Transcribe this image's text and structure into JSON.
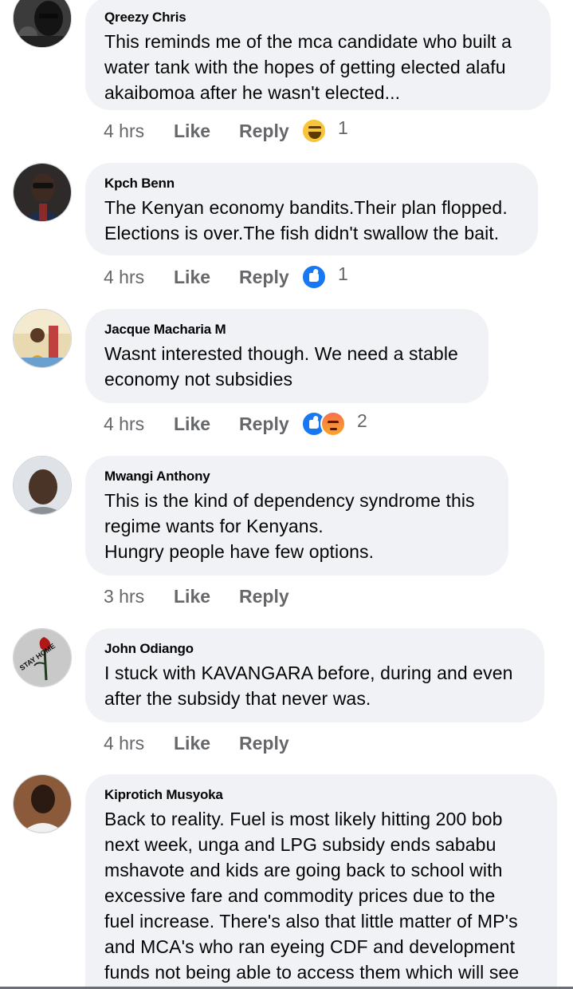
{
  "comments": [
    {
      "author": "Qreezy Chris",
      "text": "This reminds me of the mca candidate who built a\nwater tank with the hopes of getting elected alafu\nakaibomoa after he wasn't elected...",
      "time": "4 hrs",
      "like": "Like",
      "reply": "Reply",
      "reactions": [
        "haha-icon"
      ],
      "reaction_count": "1",
      "avatar_color": "#2b2b2b"
    },
    {
      "author": "Kpch Benn",
      "text": "The Kenyan economy bandits.Their plan flopped.\nElections is over.The fish didn't swallow the bait.",
      "time": "4 hrs",
      "like": "Like",
      "reply": "Reply",
      "reactions": [
        "like-icon"
      ],
      "reaction_count": "1",
      "avatar_color": "#3a2a22"
    },
    {
      "author": "Jacque Macharia M",
      "text": "Wasnt interested though. We need a stable\neconomy not subsidies",
      "time": "4 hrs",
      "like": "Like",
      "reply": "Reply",
      "reactions": [
        "like-icon",
        "angry-icon"
      ],
      "reaction_count": "2",
      "avatar_color": "#c9a96a"
    },
    {
      "author": "Mwangi Anthony",
      "text": "This is the kind of dependency syndrome this\nregime wants for Kenyans.\nHungry people have few options.",
      "time": "3 hrs",
      "like": "Like",
      "reply": "Reply",
      "reactions": [],
      "reaction_count": "",
      "avatar_color": "#9aa0a6"
    },
    {
      "author": "John Odiango",
      "text": "I stuck with KAVANGARA before, during and even\nafter the subsidy that never was.",
      "time": "4 hrs",
      "like": "Like",
      "reply": "Reply",
      "reactions": [],
      "reaction_count": "",
      "avatar_color": "#b8b8b8"
    },
    {
      "author": "Kiprotich Musyoka",
      "text": "Back to reality. Fuel is most likely hitting 200 bob\nnext week, unga and LPG subsidy ends sababu\nmshavote and kids are going back to school with\nexcessive fare and commodity prices due to the\nfuel increase. There's also that little matter of MP's\nand MCA's who ran eyeing CDF and development\nfunds not being able to access them which will see",
      "time": "",
      "like": "",
      "reply": "",
      "reactions": [],
      "reaction_count": "",
      "avatar_color": "#6b4a32"
    }
  ],
  "avatars": {
    "c0_caption": "",
    "c4_caption": "STAY HOME"
  },
  "colors": {
    "bubble_bg": "#f0f2f5",
    "meta_text": "#65676b",
    "like_blue": "#1877f2"
  }
}
